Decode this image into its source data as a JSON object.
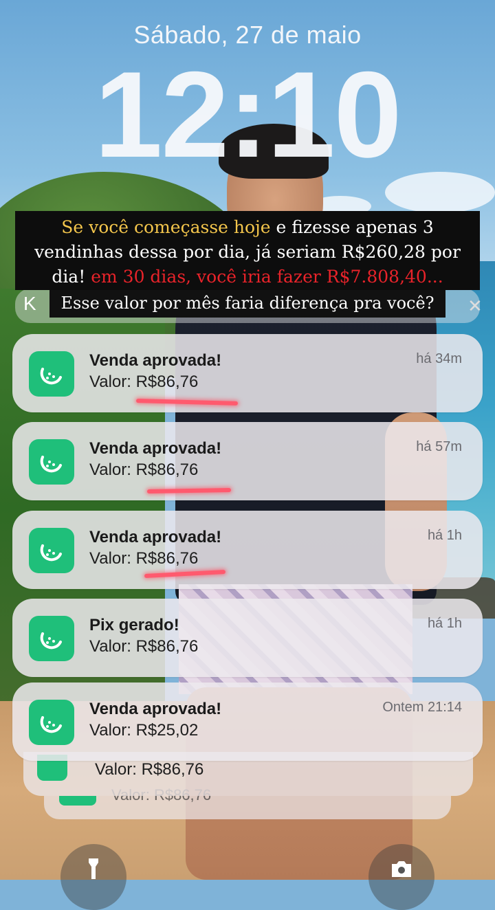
{
  "lockscreen": {
    "date": "Sábado, 27 de maio",
    "time": "12:10"
  },
  "caption": {
    "part1_gold": "Se você começasse hoje",
    "part2": " e fizesse apenas 3 vendinhas dessa por dia, já seriam R$260,28 por dia! ",
    "part3_red": "em 30 dias, você iria fazer R$7.808,40...",
    "line2": "Esse valor por mês faria diferença pra você?"
  },
  "colors": {
    "app_icon": "#1fbf7a",
    "caption_gold": "#f4c64c",
    "caption_red": "#e8232a",
    "underline": "#ff5a6e"
  },
  "notifications": [
    {
      "title": "Venda aprovada!",
      "body": "Valor: R$86,76",
      "time": "há 34m",
      "icon": "watermelon-icon"
    },
    {
      "title": "Venda aprovada!",
      "body": "Valor: R$86,76",
      "time": "há 57m",
      "icon": "watermelon-icon"
    },
    {
      "title": "Venda aprovada!",
      "body": "Valor: R$86,76",
      "time": "há 1h",
      "icon": "watermelon-icon"
    },
    {
      "title": "Pix gerado!",
      "body": "Valor: R$86,76",
      "time": "há 1h",
      "icon": "watermelon-icon"
    },
    {
      "title": "Venda aprovada!",
      "body": "Valor: R$25,02",
      "time": "Ontem 21:14",
      "icon": "watermelon-icon"
    }
  ],
  "stacked": {
    "body1": "Valor: R$86,76",
    "body2": "Valor: R$86,76"
  },
  "buttons": {
    "left_icon": "flashlight-icon",
    "right_icon": "camera-icon"
  }
}
